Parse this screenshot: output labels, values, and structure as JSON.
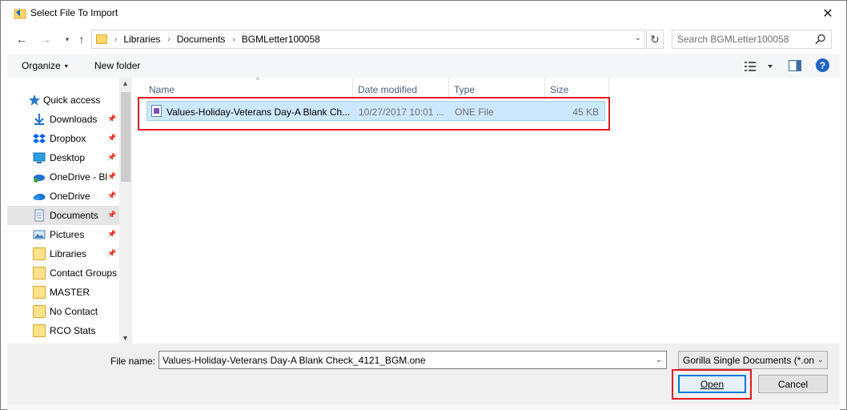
{
  "window": {
    "title": "Select File To Import",
    "close_glyph": "✕"
  },
  "nav": {
    "back_glyph": "←",
    "forward_glyph": "→",
    "recent_glyph": "▾",
    "up_glyph": "↑",
    "refresh_glyph": "↻",
    "breadcrumbs": [
      "Libraries",
      "Documents",
      "BGMLetter100058"
    ],
    "crumb_sep": "›",
    "search_placeholder": "Search BGMLetter100058"
  },
  "toolbar": {
    "organize_label": "Organize",
    "new_folder_label": "New folder",
    "caret": "▾",
    "help_label": "?"
  },
  "sidebar": {
    "quick_access": "Quick access",
    "items": [
      {
        "label": "Downloads",
        "icon": "download-icon",
        "pinned": true
      },
      {
        "label": "Dropbox",
        "icon": "dropbox-icon",
        "pinned": true
      },
      {
        "label": "Desktop",
        "icon": "desktop-icon",
        "pinned": true
      },
      {
        "label": "OneDrive - Bl",
        "icon": "onedrive-business-icon",
        "pinned": true
      },
      {
        "label": "OneDrive",
        "icon": "onedrive-icon",
        "pinned": true
      },
      {
        "label": "Documents",
        "icon": "documents-icon",
        "pinned": true,
        "selected": true
      },
      {
        "label": "Pictures",
        "icon": "pictures-icon",
        "pinned": true
      },
      {
        "label": "Libraries",
        "icon": "folder-icon",
        "pinned": true
      },
      {
        "label": "Contact Groups",
        "icon": "folder-icon",
        "pinned": false
      },
      {
        "label": "MASTER",
        "icon": "folder-icon",
        "pinned": false
      },
      {
        "label": "No Contact",
        "icon": "folder-icon",
        "pinned": false
      },
      {
        "label": "RCO Stats",
        "icon": "folder-icon",
        "pinned": false
      }
    ],
    "pin_glyph": "📌"
  },
  "columns": {
    "name": "Name",
    "date": "Date modified",
    "type": "Type",
    "size": "Size",
    "sort_glyph": "^"
  },
  "files": [
    {
      "name": "Values-Holiday-Veterans Day-A Blank Ch...",
      "date": "10/27/2017 10:01 ...",
      "type": "ONE File",
      "size": "45 KB"
    }
  ],
  "bottom": {
    "file_name_label": "File name:",
    "file_name_value": "Values-Holiday-Veterans Day-A Blank Check_4121_BGM.one",
    "file_type_value": "Gorilla Single Documents  (*.on",
    "open_label": "Open",
    "cancel_label": "Cancel",
    "drop_glyph": "⌄"
  },
  "colors": {
    "highlight": "#e0191f",
    "selection": "#cce8ff",
    "accent": "#0078d7"
  }
}
